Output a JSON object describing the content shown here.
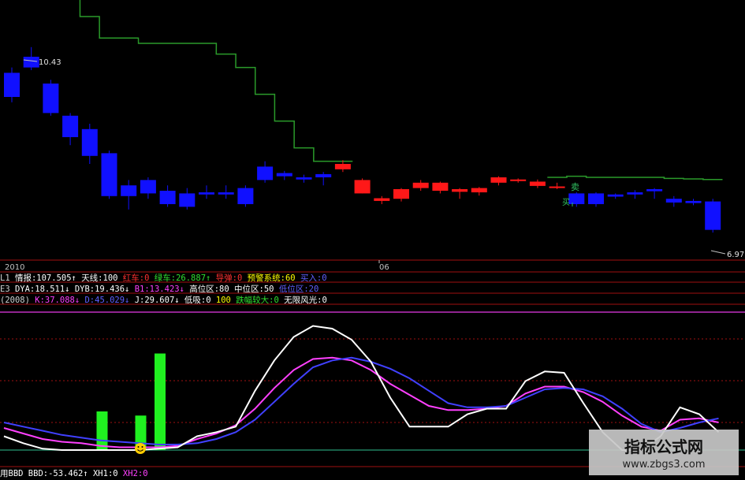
{
  "chart_data": [
    {
      "type": "candlestick",
      "price_labels": {
        "high": "10.43",
        "low": "6.97"
      },
      "date_labels": [
        "2010",
        "06"
      ],
      "buy_label": "买",
      "sell_label": "卖",
      "candles": [
        {
          "o": 9.95,
          "c": 9.5,
          "h": 10.05,
          "l": 9.4,
          "color": "blue"
        },
        {
          "o": 10.25,
          "c": 10.05,
          "h": 10.43,
          "l": 10.0,
          "color": "blue"
        },
        {
          "o": 9.75,
          "c": 9.2,
          "h": 9.82,
          "l": 9.15,
          "color": "blue"
        },
        {
          "o": 9.15,
          "c": 8.75,
          "h": 9.2,
          "l": 8.6,
          "color": "blue"
        },
        {
          "o": 8.9,
          "c": 8.4,
          "h": 9.0,
          "l": 8.25,
          "color": "blue"
        },
        {
          "o": 8.45,
          "c": 7.65,
          "h": 8.5,
          "l": 7.6,
          "color": "blue"
        },
        {
          "o": 7.85,
          "c": 7.65,
          "h": 7.95,
          "l": 7.4,
          "color": "blue"
        },
        {
          "o": 7.95,
          "c": 7.7,
          "h": 8.0,
          "l": 7.6,
          "color": "blue"
        },
        {
          "o": 7.75,
          "c": 7.5,
          "h": 7.85,
          "l": 7.45,
          "color": "blue"
        },
        {
          "o": 7.7,
          "c": 7.45,
          "h": 7.8,
          "l": 7.4,
          "color": "blue"
        },
        {
          "o": 7.72,
          "c": 7.68,
          "h": 7.85,
          "l": 7.6,
          "color": "blue"
        },
        {
          "o": 7.72,
          "c": 7.68,
          "h": 7.85,
          "l": 7.6,
          "color": "blue"
        },
        {
          "o": 7.8,
          "c": 7.5,
          "h": 7.85,
          "l": 7.45,
          "color": "blue"
        },
        {
          "o": 8.2,
          "c": 7.95,
          "h": 8.3,
          "l": 7.9,
          "color": "blue"
        },
        {
          "o": 8.08,
          "c": 8.02,
          "h": 8.12,
          "l": 7.95,
          "color": "blue"
        },
        {
          "o": 8.0,
          "c": 7.96,
          "h": 8.05,
          "l": 7.9,
          "color": "blue"
        },
        {
          "o": 8.06,
          "c": 8.0,
          "h": 8.1,
          "l": 7.85,
          "color": "blue"
        },
        {
          "o": 8.15,
          "c": 8.25,
          "h": 8.32,
          "l": 8.1,
          "color": "red"
        },
        {
          "o": 7.7,
          "c": 7.95,
          "h": 7.98,
          "l": 7.7,
          "color": "red"
        },
        {
          "o": 7.56,
          "c": 7.61,
          "h": 7.65,
          "l": 7.5,
          "color": "red"
        },
        {
          "o": 7.6,
          "c": 7.78,
          "h": 7.8,
          "l": 7.55,
          "color": "red"
        },
        {
          "o": 7.8,
          "c": 7.9,
          "h": 7.95,
          "l": 7.75,
          "color": "red"
        },
        {
          "o": 7.75,
          "c": 7.9,
          "h": 7.92,
          "l": 7.7,
          "color": "red"
        },
        {
          "o": 7.73,
          "c": 7.78,
          "h": 7.8,
          "l": 7.6,
          "color": "red"
        },
        {
          "o": 7.72,
          "c": 7.8,
          "h": 7.82,
          "l": 7.66,
          "color": "red"
        },
        {
          "o": 7.9,
          "c": 8.0,
          "h": 8.02,
          "l": 7.85,
          "color": "red"
        },
        {
          "o": 7.93,
          "c": 7.96,
          "h": 7.98,
          "l": 7.9,
          "color": "red"
        },
        {
          "o": 7.84,
          "c": 7.92,
          "h": 7.96,
          "l": 7.8,
          "color": "red"
        },
        {
          "o": 7.8,
          "c": 7.83,
          "h": 7.9,
          "l": 7.78,
          "color": "red"
        },
        {
          "o": 7.7,
          "c": 7.5,
          "h": 7.72,
          "l": 7.45,
          "color": "blue"
        },
        {
          "o": 7.7,
          "c": 7.5,
          "h": 7.72,
          "l": 7.45,
          "color": "blue"
        },
        {
          "o": 7.68,
          "c": 7.64,
          "h": 7.7,
          "l": 7.6,
          "color": "blue"
        },
        {
          "o": 7.72,
          "c": 7.68,
          "h": 7.76,
          "l": 7.6,
          "color": "blue"
        },
        {
          "o": 7.78,
          "c": 7.74,
          "h": 7.8,
          "l": 7.6,
          "color": "blue"
        },
        {
          "o": 7.6,
          "c": 7.53,
          "h": 7.65,
          "l": 7.45,
          "color": "blue"
        },
        {
          "o": 7.56,
          "c": 7.52,
          "h": 7.6,
          "l": 7.48,
          "color": "blue"
        },
        {
          "o": 7.55,
          "c": 7.02,
          "h": 7.6,
          "l": 6.97,
          "color": "blue"
        }
      ],
      "stop_line": [
        11.6,
        11.6,
        11.6,
        11.6,
        11.0,
        10.6,
        10.6,
        10.5,
        10.5,
        10.5,
        10.5,
        10.3,
        10.05,
        9.55,
        9.05,
        8.55,
        8.3,
        8.3,
        null,
        null,
        null,
        null,
        null,
        null,
        null,
        null,
        null,
        null,
        8.0,
        8.02,
        8.0,
        8.0,
        8.0,
        8.0,
        7.98,
        7.97,
        7.96
      ]
    },
    {
      "type": "indicator-panel",
      "rows": [
        {
          "prefix": "L1",
          "items": [
            {
              "text": "情报:107.505",
              "arrow": "↑",
              "color": "#ffffff"
            },
            {
              "text": "天线:100",
              "color": "#ffffff"
            },
            {
              "text": "红车:0",
              "color": "#ff3030"
            },
            {
              "text": "绿车:26.887",
              "arrow": "↑",
              "color": "#30e030"
            },
            {
              "text": "导弹:0",
              "color": "#ff3030"
            },
            {
              "text": "预警系统:60",
              "color": "#ffff00"
            },
            {
              "text": "买入:0",
              "color": "#6060ff"
            }
          ]
        },
        {
          "prefix": "E3",
          "items": [
            {
              "text": "DYA:18.511",
              "arrow": "↓",
              "color": "#ffffff"
            },
            {
              "text": "DYB:19.436",
              "arrow": "↓",
              "color": "#ffffff"
            },
            {
              "text": "B1:13.423",
              "arrow": "↓",
              "color": "#ff40ff"
            },
            {
              "text": "高位区:80",
              "color": "#ffffff"
            },
            {
              "text": "中位区:50",
              "color": "#ffffff"
            },
            {
              "text": "低位区:20",
              "color": "#6060ff"
            }
          ]
        },
        {
          "prefix": "(2008)",
          "items": [
            {
              "text": "K:37.088",
              "arrow": "↓",
              "color": "#ff40ff"
            },
            {
              "text": "D:45.029",
              "arrow": "↓",
              "color": "#6060ff"
            },
            {
              "text": "J:29.607",
              "arrow": "↓",
              "color": "#ffffff"
            },
            {
              "text": "低吸:0",
              "color": "#ffffff"
            },
            {
              "text": "100",
              "color": "#ffff00"
            },
            {
              "text": "跌幅较大:0",
              "color": "#30e030"
            },
            {
              "text": "无限风光:0",
              "color": "#ffffff"
            }
          ]
        }
      ]
    },
    {
      "type": "line",
      "ylim": [
        0,
        100
      ],
      "series": [
        {
          "name": "K",
          "color": "#ff40ff",
          "values": [
            16,
            12,
            8,
            6,
            5,
            3,
            2,
            2,
            2,
            3,
            8,
            12,
            18,
            30,
            45,
            58,
            66,
            67,
            65,
            58,
            48,
            40,
            32,
            29,
            29,
            30,
            32,
            41,
            46,
            46,
            42,
            35,
            25,
            17,
            14,
            22,
            23,
            20
          ]
        },
        {
          "name": "D",
          "color": "#4040ff",
          "values": [
            20,
            17,
            14,
            11,
            9,
            7,
            6,
            5,
            4,
            4,
            5,
            8,
            13,
            22,
            35,
            48,
            60,
            65,
            67,
            64,
            59,
            52,
            43,
            34,
            31,
            31,
            32,
            38,
            44,
            45,
            44,
            39,
            30,
            19,
            13,
            16,
            20,
            23
          ]
        },
        {
          "name": "J",
          "color": "#ffffff",
          "values": [
            10,
            5,
            1,
            0,
            0,
            0,
            0,
            0,
            1,
            2,
            10,
            13,
            17,
            43,
            65,
            82,
            90,
            88,
            80,
            64,
            38,
            17,
            17,
            17,
            26,
            30,
            30,
            50,
            57,
            56,
            34,
            13,
            0,
            0,
            10,
            31,
            26,
            13
          ]
        }
      ],
      "green_bars": [
        {
          "i": 5,
          "h": 28
        },
        {
          "i": 7,
          "h": 25
        },
        {
          "i": 8,
          "h": 70
        }
      ],
      "bottom_row": [
        {
          "text": "用BBD",
          "color": "#ffffff"
        },
        {
          "text": "BBD:-53.462",
          "arrow": "↑",
          "color": "#ffffff"
        },
        {
          "text": "XH1:0",
          "color": "#ffffff"
        },
        {
          "text": "XH2:0",
          "color": "#ff40ff"
        }
      ]
    }
  ],
  "watermark": {
    "title": "指标公式网",
    "url": "www.zbgs3.com"
  }
}
